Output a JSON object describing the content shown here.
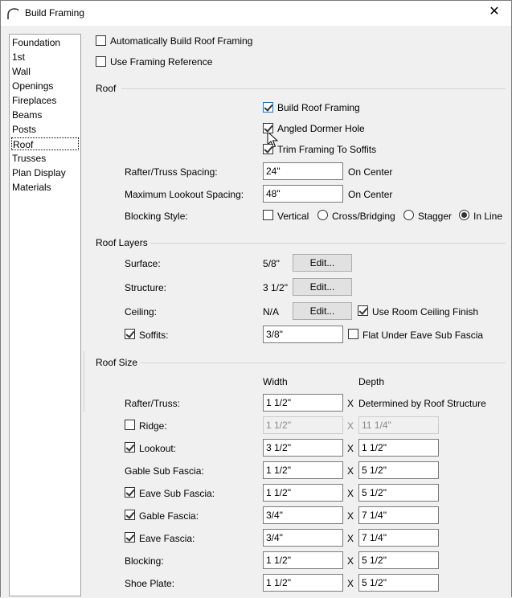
{
  "window": {
    "title": "Build Framing"
  },
  "nav": {
    "items": [
      "Foundation",
      "1st",
      "Wall",
      "Openings",
      "Fireplaces",
      "Beams",
      "Posts",
      "Roof",
      "Trusses",
      "Plan Display",
      "Materials"
    ],
    "selected": "Roof"
  },
  "top_options": {
    "auto_build_label": "Automatically Build Roof Framing",
    "auto_build_checked": false,
    "use_ref_label": "Use Framing Reference",
    "use_ref_checked": false
  },
  "roof": {
    "section_title": "Roof",
    "build_label": "Build Roof Framing",
    "build_checked": true,
    "angled_label": "Angled Dormer Hole",
    "angled_checked": true,
    "trim_label": "Trim Framing To Soffits",
    "trim_checked": true,
    "rafter_spacing_label": "Rafter/Truss Spacing:",
    "rafter_spacing_value": "24\"",
    "rafter_spacing_unit": "On Center",
    "lookout_spacing_label": "Maximum Lookout Spacing:",
    "lookout_spacing_value": "48\"",
    "lookout_spacing_unit": "On Center",
    "blocking_label": "Blocking Style:",
    "blocking_vertical_label": "Vertical",
    "blocking_vertical_checked": false,
    "blocking_cross_label": "Cross/Bridging",
    "blocking_stagger_label": "Stagger",
    "blocking_inline_label": "In Line",
    "blocking_selected": "In Line"
  },
  "roof_layers": {
    "section_title": "Roof Layers",
    "surface_label": "Surface:",
    "surface_value": "5/8\"",
    "structure_label": "Structure:",
    "structure_value": "3 1/2\"",
    "ceiling_label": "Ceiling:",
    "ceiling_value": "N/A",
    "edit_label": "Edit...",
    "use_room_ceiling_label": "Use Room Ceiling Finish",
    "use_room_ceiling_checked": true,
    "soffits_label": "Soffits:",
    "soffits_checked": true,
    "soffits_value": "3/8\"",
    "flat_under_label": "Flat Under Eave Sub Fascia",
    "flat_under_checked": false
  },
  "roof_size": {
    "section_title": "Roof Size",
    "width_header": "Width",
    "depth_header": "Depth",
    "x": "X",
    "rows": [
      {
        "label": "Rafter/Truss:",
        "width": "1 1/2\"",
        "depth_text": "Determined by Roof Structure"
      },
      {
        "label": "Ridge:",
        "width": "1 1/2\"",
        "depth": "11 1/4\"",
        "checked": false,
        "disabled": true
      },
      {
        "label": "Lookout:",
        "width": "3 1/2\"",
        "depth": "1 1/2\"",
        "checked": true
      },
      {
        "label": "Gable Sub Fascia:",
        "width": "1 1/2\"",
        "depth": "5 1/2\""
      },
      {
        "label": "Eave Sub Fascia:",
        "width": "1 1/2\"",
        "depth": "5 1/2\"",
        "checked": true
      },
      {
        "label": "Gable Fascia:",
        "width": "3/4\"",
        "depth": "7 1/4\"",
        "checked": true
      },
      {
        "label": "Eave Fascia:",
        "width": "3/4\"",
        "depth": "7 1/4\"",
        "checked": true
      },
      {
        "label": "Blocking:",
        "width": "1 1/2\"",
        "depth": "5 1/2\""
      },
      {
        "label": "Shoe Plate:",
        "width": "1 1/2\"",
        "depth": "5 1/2\""
      }
    ]
  },
  "icons": {
    "app": "roof-arc-icon",
    "close": "close-icon",
    "cursor": "mouse-pointer-icon"
  }
}
